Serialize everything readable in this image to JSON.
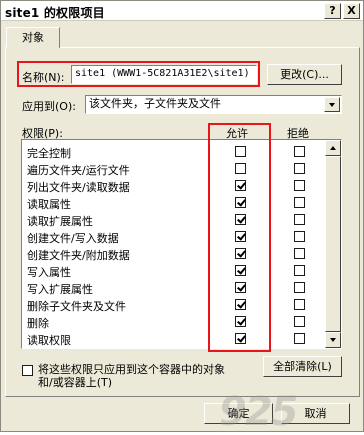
{
  "window": {
    "title": "site1 的权限项目",
    "help_button": "?",
    "close_button": "X"
  },
  "tab": {
    "label": "对象"
  },
  "name_row": {
    "label": "名称(N):",
    "value": "site1 (WWW1-5C821A31E2\\site1)",
    "change_button": "更改(C)..."
  },
  "apply_row": {
    "label": "应用到(O):",
    "value": "该文件夹，子文件夹及文件"
  },
  "permissions": {
    "header_label": "权限(P):",
    "allow_header": "允许",
    "deny_header": "拒绝",
    "rows": [
      {
        "name": "完全控制",
        "allow": false,
        "deny": false
      },
      {
        "name": "遍历文件夹/运行文件",
        "allow": false,
        "deny": false
      },
      {
        "name": "列出文件夹/读取数据",
        "allow": true,
        "deny": false
      },
      {
        "name": "读取属性",
        "allow": true,
        "deny": false
      },
      {
        "name": "读取扩展属性",
        "allow": true,
        "deny": false
      },
      {
        "name": "创建文件/写入数据",
        "allow": true,
        "deny": false
      },
      {
        "name": "创建文件夹/附加数据",
        "allow": true,
        "deny": false
      },
      {
        "name": "写入属性",
        "allow": true,
        "deny": false
      },
      {
        "name": "写入扩展属性",
        "allow": true,
        "deny": false
      },
      {
        "name": "删除子文件夹及文件",
        "allow": true,
        "deny": false
      },
      {
        "name": "删除",
        "allow": true,
        "deny": false
      },
      {
        "name": "读取权限",
        "allow": true,
        "deny": false
      }
    ]
  },
  "apply_only": {
    "line1": "将这些权限只应用到这个容器中的对象",
    "line2": "和/或容器上(T)",
    "checked": false
  },
  "clear_all_button": "全部清除(L)",
  "footer": {
    "ok_button": "确定",
    "cancel_button": "取消"
  },
  "watermark": "925"
}
